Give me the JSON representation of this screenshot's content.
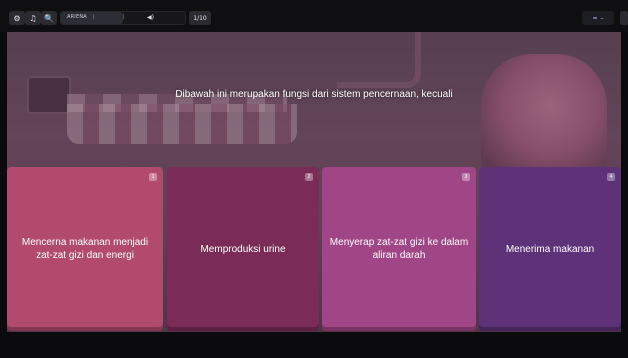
{
  "toolbar": {
    "player_name": "ARIENA",
    "sound_label": "◀)",
    "counter": "1/10",
    "progress_fraction": 0.5,
    "right_pill_label": "≈",
    "right_pill_dash": "–"
  },
  "question": {
    "text": "Dibawah ini merupakan fungsi dari sistem pencernaan, kecuali"
  },
  "answers": [
    {
      "number": "1",
      "text": "Mencerna makanan menjadi zat-zat gizi dan energi",
      "color": "#b14a6c"
    },
    {
      "number": "2",
      "text": "Memproduksi urine",
      "color": "#7a2b58"
    },
    {
      "number": "3",
      "text": "Menyerap zat-zat gizi ke dalam aliran darah",
      "color": "#a04585"
    },
    {
      "number": "4",
      "text": "Menerima makanan",
      "color": "#5d3278"
    }
  ],
  "colors": {
    "toolbar_bg": "#0f0f12",
    "page_bg": "#0b0b0d"
  }
}
